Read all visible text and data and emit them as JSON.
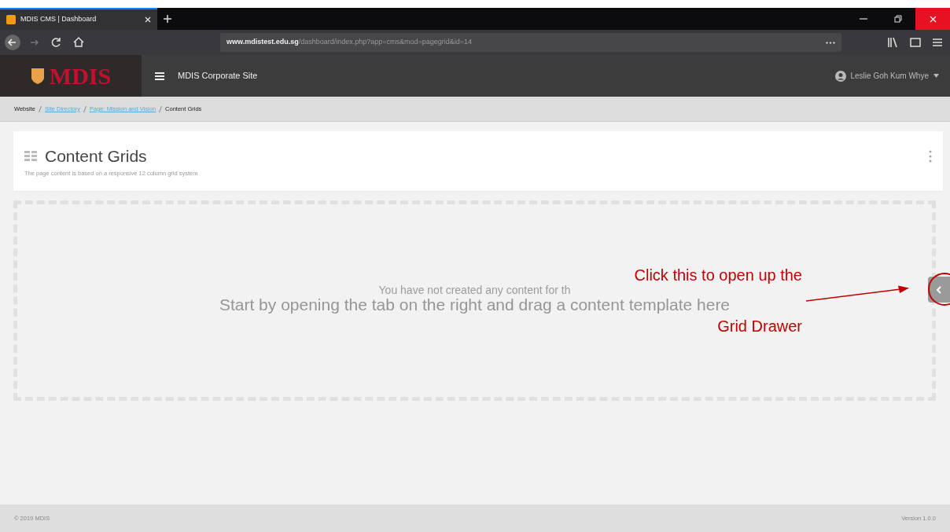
{
  "browser": {
    "tab_title": "MDIS CMS | Dashboard",
    "url_host": "www.mdistest.edu.sg",
    "url_path": "/dashboard/index.php?app=cms&mod=pagegrid&id=14"
  },
  "navbar": {
    "logo": "MDIS",
    "site": "MDIS Corporate Site",
    "user": "Leslie Goh Kum Whye"
  },
  "breadcrumb": [
    {
      "label": "Website",
      "link": false
    },
    {
      "label": "Site Directory",
      "link": true
    },
    {
      "label": "Page: Mission and Vision",
      "link": true
    },
    {
      "label": "Content Grids",
      "link": false
    }
  ],
  "header": {
    "title": "Content Grids",
    "subtitle": "The page content is based on a responsive 12 column grid system"
  },
  "empty_state": {
    "line_1": "You have not created any content for th",
    "line_2": "Start by opening the tab on the right and drag a content template here"
  },
  "annotation": {
    "line_1": "Click this to open up the",
    "line_2": "Grid Drawer"
  },
  "footer": {
    "copyright": "© 2019 MDIS",
    "version": "Version 1.0.0"
  }
}
